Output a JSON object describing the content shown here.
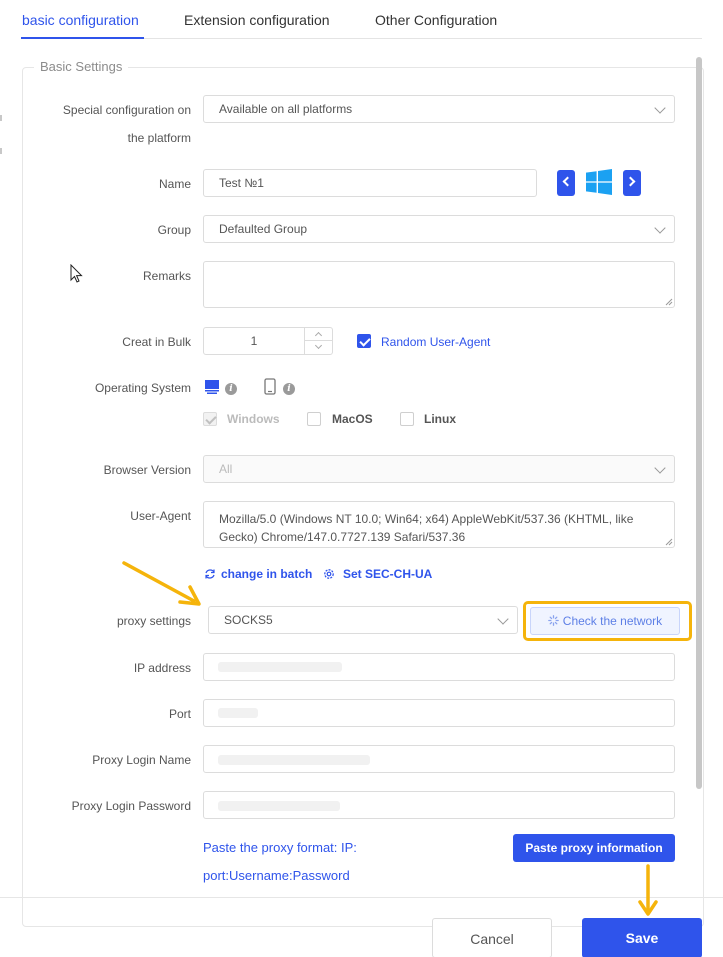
{
  "tabs": [
    {
      "label": "basic configuration",
      "active": true
    },
    {
      "label": "Extension configuration",
      "active": false
    },
    {
      "label": "Other Configuration",
      "active": false
    }
  ],
  "section": {
    "legend": "Basic Settings"
  },
  "platform": {
    "label_line1": "Special configuration on",
    "label_line2": "the platform",
    "value": "Available on all platforms"
  },
  "name": {
    "label": "Name",
    "value": "Test №1",
    "os_icon": "windows-logo-icon"
  },
  "group": {
    "label": "Group",
    "value": "Defaulted Group"
  },
  "remarks": {
    "label": "Remarks",
    "value": ""
  },
  "bulk": {
    "label": "Creat in Bulk",
    "value": "1",
    "random_ua_label": "Random User-Agent",
    "random_ua_checked": true
  },
  "os": {
    "label": "Operating System",
    "device_icons": [
      "desktop-icon",
      "mobile-icon"
    ],
    "options": [
      {
        "label": "Windows",
        "checked": true,
        "disabled": true
      },
      {
        "label": "MacOS",
        "checked": false,
        "disabled": false
      },
      {
        "label": "Linux",
        "checked": false,
        "disabled": false
      }
    ]
  },
  "browser": {
    "label": "Browser Version",
    "value": "All"
  },
  "ua": {
    "label": "User-Agent",
    "value_line1": "Mozilla/5.0 (Windows NT 10.0; Win64; x64) AppleWebKit/537.36 (KHTML, like",
    "value_line2": "Gecko) Chrome/147.0.7727.139 Safari/537.36",
    "change_batch": "change in batch",
    "set_ch": "Set SEC-CH-UA"
  },
  "proxy": {
    "label": "proxy settings",
    "value": "SOCKS5",
    "check_label": "Check the network"
  },
  "ip": {
    "label": "IP address"
  },
  "port": {
    "label": "Port"
  },
  "login": {
    "label": "Proxy Login Name"
  },
  "password": {
    "label": "Proxy Login Password"
  },
  "paste": {
    "hint_line1": "Paste the proxy format: IP:",
    "hint_line2": "port:Username:Password",
    "button": "Paste proxy information"
  },
  "footer": {
    "cancel": "Cancel",
    "save": "Save"
  },
  "colors": {
    "accent": "#2f54eb",
    "annotation": "#f5b40b"
  }
}
